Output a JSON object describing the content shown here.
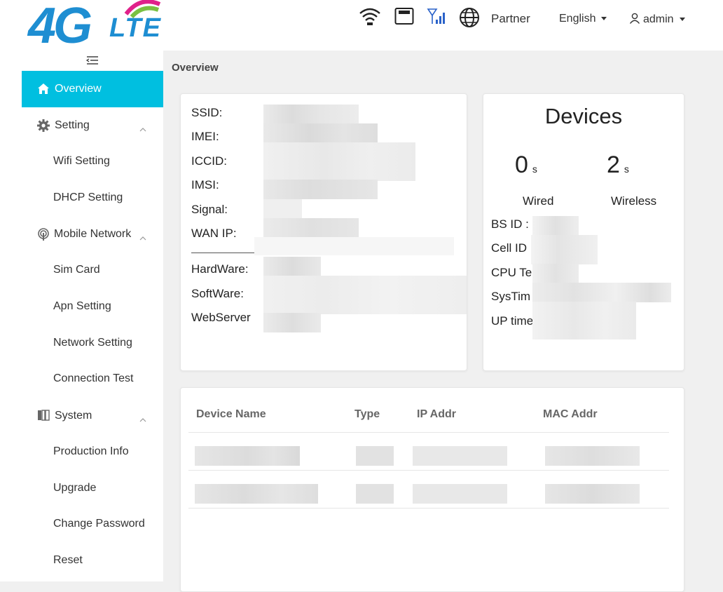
{
  "header": {
    "logo": {
      "main": "4G",
      "sub": "LTE"
    },
    "icons": [
      "wifi-icon",
      "sim-icon",
      "signal-icon",
      "globe-icon"
    ],
    "partner_label": "Partner",
    "language": "English",
    "user": "admin"
  },
  "sidebar": {
    "items": [
      {
        "label": "Overview",
        "icon": "home-icon",
        "active": true
      },
      {
        "label": "Setting",
        "icon": "gear-icon",
        "expanded": true
      },
      {
        "label": "Wifi Setting"
      },
      {
        "label": "DHCP Setting"
      },
      {
        "label": "Mobile Network",
        "icon": "antenna-icon",
        "expanded": true
      },
      {
        "label": "Sim Card"
      },
      {
        "label": "Apn Setting"
      },
      {
        "label": "Network Setting"
      },
      {
        "label": "Connection Test"
      },
      {
        "label": "System",
        "icon": "system-icon",
        "expanded": true
      },
      {
        "label": "Production Info"
      },
      {
        "label": "Upgrade"
      },
      {
        "label": "Change Password"
      },
      {
        "label": "Reset"
      }
    ]
  },
  "main": {
    "breadcrumb": "Overview",
    "info": {
      "labels": [
        "SSID:",
        "IMEI:",
        "ICCID:",
        "IMSI:",
        "Signal:",
        "WAN IP:",
        "HardWare:",
        "SoftWare:",
        "WebServer"
      ]
    },
    "devices": {
      "title": "Devices",
      "wired_count": "0",
      "wireless_count": "2",
      "unit": "s",
      "wired_label": "Wired",
      "wireless_label": "Wireless",
      "details": [
        "BS ID :",
        "Cell ID",
        "CPU Te",
        "SysTim",
        "UP time"
      ]
    },
    "table": {
      "columns": [
        "Device Name",
        "Type",
        "IP Addr",
        "MAC Addr"
      ]
    }
  },
  "colors": {
    "accent": "#00bfe0",
    "logo_blue": "#1e8ed2",
    "background": "#f0f0f0"
  }
}
